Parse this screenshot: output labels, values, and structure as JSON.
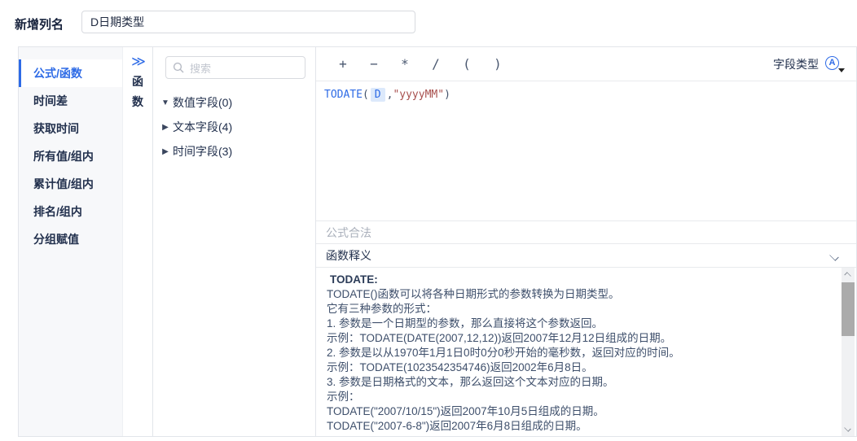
{
  "header": {
    "label": "新增列名",
    "input_value": "D日期类型"
  },
  "sidebar": {
    "items": [
      {
        "label": "公式/函数",
        "active": true
      },
      {
        "label": "时间差",
        "active": false
      },
      {
        "label": "获取时间",
        "active": false
      },
      {
        "label": "所有值/组内",
        "active": false
      },
      {
        "label": "累计值/组内",
        "active": false
      },
      {
        "label": "排名/组内",
        "active": false
      },
      {
        "label": "分组赋值",
        "active": false
      }
    ]
  },
  "collapse_panel": {
    "collapse_icon": "≫",
    "chars": [
      "函",
      "数"
    ]
  },
  "fields": {
    "search_placeholder": "搜索",
    "groups": [
      {
        "arrow": "▼",
        "label": "数值字段(0)",
        "expanded": true
      },
      {
        "arrow": "▶",
        "label": "文本字段(4)",
        "expanded": false
      },
      {
        "arrow": "▶",
        "label": "时间字段(3)",
        "expanded": false
      }
    ]
  },
  "toolbar": {
    "operators": [
      "+",
      "−",
      "*",
      "/",
      "(",
      ")"
    ],
    "field_type_label": "字段类型",
    "field_type_icon_letter": "A"
  },
  "formula": {
    "func": "TODATE",
    "paren_open": "(",
    "field_token": "D",
    "middle": ",",
    "string_arg": "\"yyyyMM\"",
    "paren_close": ")"
  },
  "status": {
    "text": "公式合法"
  },
  "doc": {
    "title": "函数释义",
    "lines": [
      "TODATE:",
      "TODATE()函数可以将各种日期形式的参数转换为日期类型。",
      "它有三种参数的形式：",
      "1. 参数是一个日期型的参数，那么直接将这个参数返回。",
      "示例：TODATE(DATE(2007,12,12))返回2007年12月12日组成的日期。",
      "2. 参数是以从1970年1月1日0时0分0秒开始的毫秒数，返回对应的时间。",
      "示例：TODATE(1023542354746)返回2002年6月8日。",
      "3. 参数是日期格式的文本，那么返回这个文本对应的日期。",
      "示例：",
      "TODATE(\"2007/10/15\")返回2007年10月5日组成的日期。",
      "TODATE(\"2007-6-8\")返回2007年6月8日组成的日期。"
    ]
  },
  "colors": {
    "accent_blue": "#2e6be6",
    "string_red": "#a8504e",
    "sidebar_bg": "#f7f8fa",
    "doc_text": "#3e4f6b"
  }
}
